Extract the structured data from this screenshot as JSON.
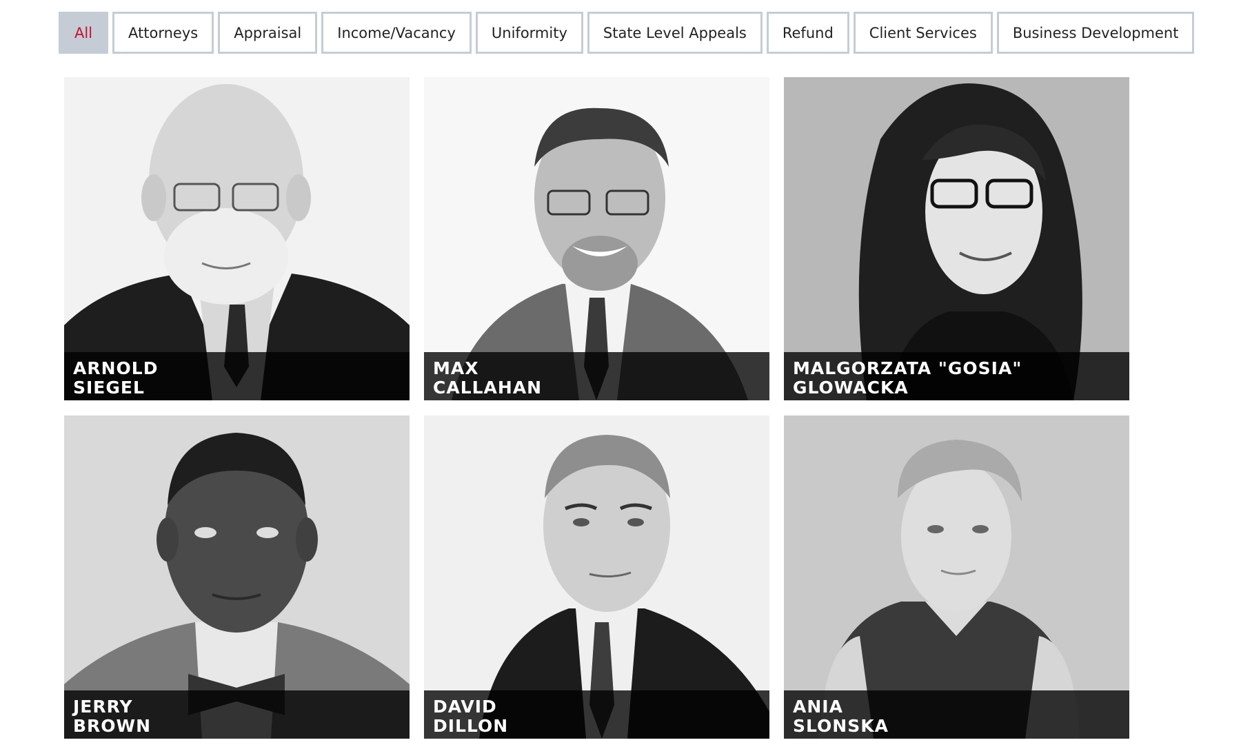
{
  "filters": [
    {
      "label": "All",
      "active": true
    },
    {
      "label": "Attorneys",
      "active": false
    },
    {
      "label": "Appraisal",
      "active": false
    },
    {
      "label": "Income/Vacancy",
      "active": false
    },
    {
      "label": "Uniformity",
      "active": false
    },
    {
      "label": "State Level Appeals",
      "active": false
    },
    {
      "label": "Refund",
      "active": false
    },
    {
      "label": "Client Services",
      "active": false
    },
    {
      "label": "Business Development",
      "active": false
    }
  ],
  "colors": {
    "active_text": "#c8102e",
    "active_bg": "#c5ccd6",
    "border": "#c5ccd6",
    "name_band": "#000000"
  },
  "team": [
    {
      "first": "ARNOLD",
      "last": "SIEGEL"
    },
    {
      "first": "MAX",
      "last": "CALLAHAN"
    },
    {
      "first": "MALGORZATA \"GOSIA\"",
      "last": "GLOWACKA"
    },
    {
      "first": "JERRY",
      "last": "BROWN"
    },
    {
      "first": "DAVID",
      "last": "DILLON"
    },
    {
      "first": "ANIA",
      "last": "SLONSKA"
    }
  ]
}
